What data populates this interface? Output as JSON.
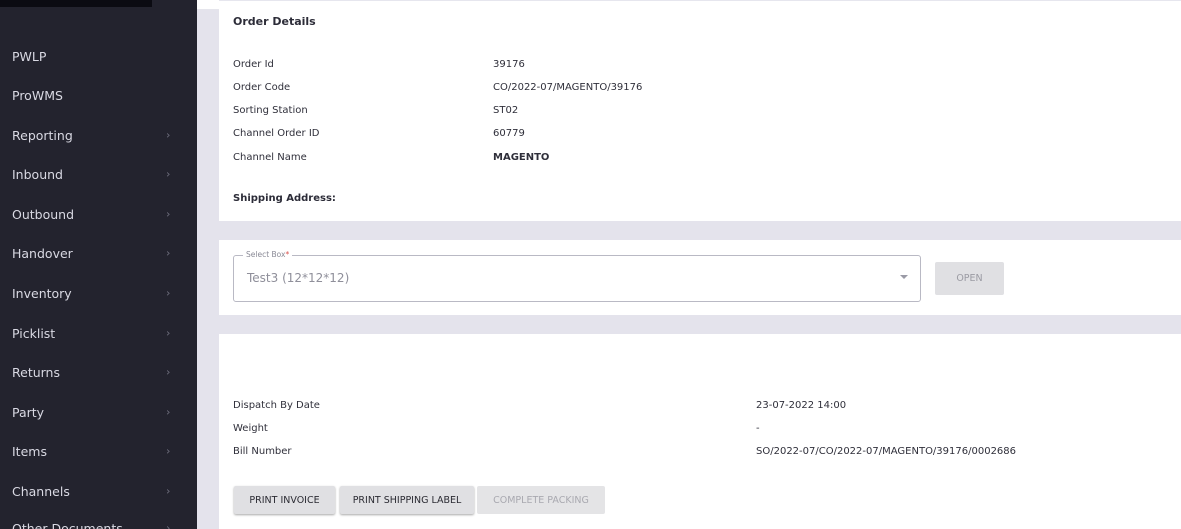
{
  "sidebar": {
    "items": [
      {
        "label": "PWLP",
        "chevron": false
      },
      {
        "label": "ProWMS",
        "chevron": false
      },
      {
        "label": "Reporting",
        "chevron": true
      },
      {
        "label": "Inbound",
        "chevron": true
      },
      {
        "label": "Outbound",
        "chevron": true
      },
      {
        "label": "Handover",
        "chevron": true
      },
      {
        "label": "Inventory",
        "chevron": true
      },
      {
        "label": "Picklist",
        "chevron": true
      },
      {
        "label": "Returns",
        "chevron": true
      },
      {
        "label": "Party",
        "chevron": true
      },
      {
        "label": "Items",
        "chevron": true
      },
      {
        "label": "Channels",
        "chevron": true
      },
      {
        "label": "Other Documents",
        "chevron": true
      }
    ],
    "chevron_glyph": "›"
  },
  "order_details": {
    "title": "Order Details",
    "fields": [
      {
        "label": "Order Id",
        "value": "39176"
      },
      {
        "label": "Order Code",
        "value": "CO/2022-07/MAGENTO/39176"
      },
      {
        "label": "Sorting Station",
        "value": "ST02"
      },
      {
        "label": "Channel Order ID",
        "value": "60779"
      },
      {
        "label": "Channel Name",
        "value": "MAGENTO"
      }
    ],
    "shipping_address_label": "Shipping Address:"
  },
  "box_select": {
    "legend": "Select Box",
    "required_mark": "*",
    "value": "Test3 (12*12*12)",
    "open_button": "OPEN"
  },
  "dispatch": {
    "fields": [
      {
        "label": "Dispatch By Date",
        "value": "23-07-2022 14:00"
      },
      {
        "label": "Weight",
        "value": "-"
      },
      {
        "label": "Bill Number",
        "value": "SO/2022-07/CO/2022-07/MAGENTO/39176/0002686"
      }
    ],
    "buttons": {
      "print_invoice": "PRINT INVOICE",
      "print_shipping_label": "PRINT SHIPPING LABEL",
      "complete_packing": "COMPLETE PACKING"
    }
  }
}
